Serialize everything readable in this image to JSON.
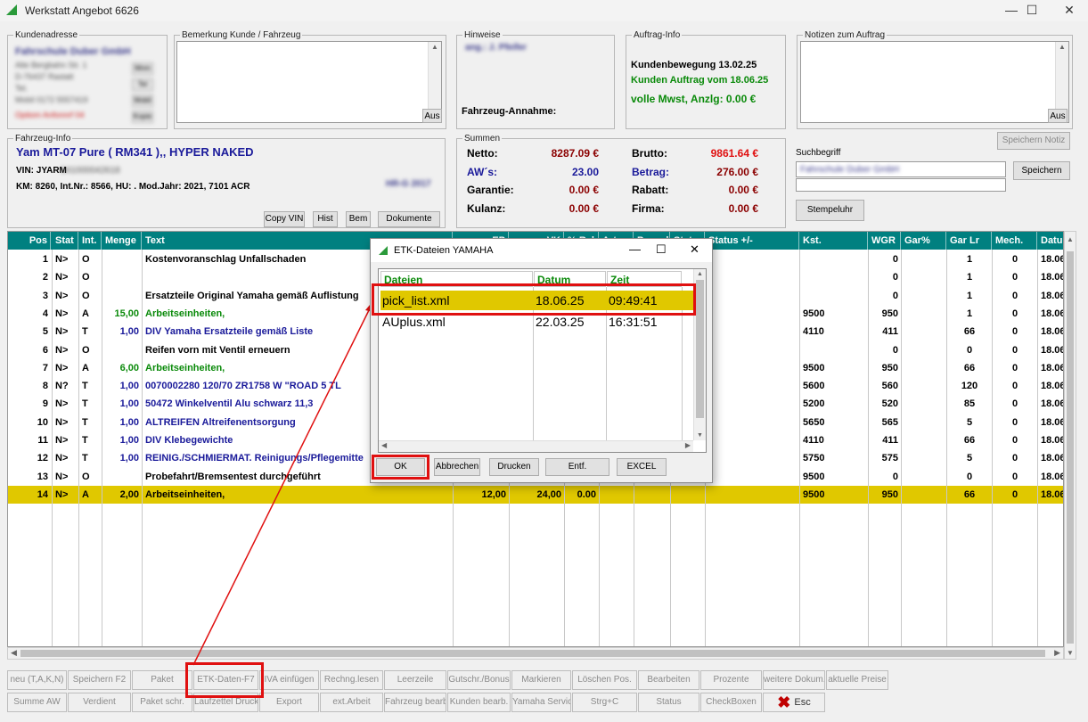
{
  "window": {
    "title": "Werkstatt Angebot 6626",
    "minimize": "—",
    "maximize": "☐",
    "close": "✕"
  },
  "kunde": {
    "legend": "Kundenadresse",
    "lines": [
      "Fahrschule Duber GmbH",
      "Alte Bergbahn Str. 1",
      "D-76437 Rastatt",
      "Tel.",
      "Mobil 0172 5557419",
      "Optiom Anfonnrf 04"
    ],
    "side_btns": [
      "Mnm",
      "Tel",
      "Mobil",
      "Kopie"
    ]
  },
  "bemerkung": {
    "legend": "Bemerkung Kunde / Fahrzeug",
    "aus": "Aus"
  },
  "hinweise": {
    "legend": "Hinweise",
    "line1": "ang.: J. Pfeifer",
    "annahme": "Fahrzeug-Annahme:"
  },
  "auftrag": {
    "legend": "Auftrag-Info",
    "line1": "Kundenbewegung 13.02.25",
    "line2": "Kunden Auftrag vom 18.06.25",
    "line3": "volle Mwst, Anzlg: 0.00 €"
  },
  "notizen": {
    "legend": "Notizen zum Auftrag",
    "aus": "Aus",
    "speichern": "Speichern Notiz"
  },
  "fahrzeug": {
    "legend": "Fahrzeug-Info",
    "title": "Yam MT-07 Pure ( RM341 ),, HYPER NAKED",
    "vin_label": "VIN: JYARM",
    "vin_blur": "341000042618",
    "km": "KM: 8260, Int.Nr.: 8566, HU:  .  Mod.Jahr: 2021, 7101 ACR",
    "plate": "HR-G 2017",
    "buttons": {
      "copy_vin": "Copy VIN",
      "hist": "Hist",
      "bem": "Bem",
      "dokumente": "Dokumente"
    }
  },
  "summen": {
    "legend": "Summen",
    "netto_l": "Netto:",
    "netto_v": "8287.09 €",
    "aws_l": "AW´s:",
    "aws_v": "23.00",
    "garantie_l": "Garantie:",
    "garantie_v": "0.00 €",
    "kulanz_l": "Kulanz:",
    "kulanz_v": "0.00 €",
    "brutto_l": "Brutto:",
    "brutto_v": "9861.64 €",
    "betrag_l": "Betrag:",
    "betrag_v": "276.00 €",
    "rabatt_l": "Rabatt:",
    "rabatt_v": "0.00 €",
    "firma_l": "Firma:",
    "firma_v": "0.00 €"
  },
  "such": {
    "label": "Suchbegriff",
    "value": "Fahrschule Duber GmbH",
    "speichern": "Speichern",
    "stempeluhr": "Stempeluhr"
  },
  "grid": {
    "headers": [
      "Pos",
      "Stat",
      "Int.",
      "Menge",
      "Text",
      "EP",
      "VK",
      "% Rab",
      "Art",
      "Pauschal",
      "Stat",
      "Status +/-",
      "Kst.",
      "WGR",
      "Gar%",
      "Gar Lr",
      "Mech.",
      "Datum"
    ],
    "rows": [
      {
        "pos": "1",
        "stat": "N>",
        "int": "O",
        "menge": "",
        "text": "Kostenvoranschlag Unfallschaden",
        "ep": "",
        "vk": "",
        "rab": "",
        "kst": "",
        "wgr": "0",
        "garlr": "1",
        "mech": "0",
        "datum": "18.06",
        "color": "#000000"
      },
      {
        "pos": "2",
        "stat": "N>",
        "int": "O",
        "menge": "",
        "text": "",
        "ep": "",
        "vk": "",
        "rab": "",
        "kst": "",
        "wgr": "0",
        "garlr": "1",
        "mech": "0",
        "datum": "18.06",
        "color": "#000000"
      },
      {
        "pos": "3",
        "stat": "N>",
        "int": "O",
        "menge": "",
        "text": "Ersatzteile Original Yamaha gemäß Auflistung",
        "ep": "",
        "vk": "",
        "rab": "",
        "kst": "",
        "wgr": "0",
        "garlr": "1",
        "mech": "0",
        "datum": "18.06",
        "color": "#000000"
      },
      {
        "pos": "4",
        "stat": "N>",
        "int": "A",
        "menge": "15,00",
        "text": "Arbeitseinheiten,",
        "ep": "",
        "vk": "",
        "rab": "",
        "kst": "9500",
        "wgr": "950",
        "garlr": "1",
        "mech": "0",
        "datum": "18.06",
        "color": "#0a8a0a"
      },
      {
        "pos": "5",
        "stat": "N>",
        "int": "T",
        "menge": "1,00",
        "text": "DIV  Yamaha Ersatzteile gemäß Liste",
        "ep": "",
        "vk": "",
        "rab": "",
        "kst": "4110",
        "wgr": "411",
        "garlr": "66",
        "mech": "0",
        "datum": "18.06",
        "color": "#1a1a9a"
      },
      {
        "pos": "6",
        "stat": "N>",
        "int": "O",
        "menge": "",
        "text": "Reifen vorn mit Ventil erneuern",
        "ep": "",
        "vk": "",
        "rab": "",
        "kst": "",
        "wgr": "0",
        "garlr": "0",
        "mech": "0",
        "datum": "18.06",
        "color": "#000000"
      },
      {
        "pos": "7",
        "stat": "N>",
        "int": "A",
        "menge": "6,00",
        "text": "Arbeitseinheiten,",
        "ep": "",
        "vk": "",
        "rab": "",
        "kst": "9500",
        "wgr": "950",
        "garlr": "66",
        "mech": "0",
        "datum": "18.06",
        "color": "#0a8a0a"
      },
      {
        "pos": "8",
        "stat": "N?",
        "int": "T",
        "menge": "1,00",
        "text": "0070002280          120/70 ZR1758 W \"ROAD 5 TL",
        "ep": "",
        "vk": "",
        "rab": "",
        "kst": "5600",
        "wgr": "560",
        "garlr": "120",
        "mech": "0",
        "datum": "18.06",
        "color": "#1a1a9a"
      },
      {
        "pos": "9",
        "stat": "N>",
        "int": "T",
        "menge": "1,00",
        "text": "50472                 Winkelventil Alu schwarz  11,3",
        "ep": "",
        "vk": "",
        "rab": "",
        "kst": "5200",
        "wgr": "520",
        "garlr": "85",
        "mech": "0",
        "datum": "18.06",
        "color": "#1a1a9a"
      },
      {
        "pos": "10",
        "stat": "N>",
        "int": "T",
        "menge": "1,00",
        "text": "ALTREIFEN           Altreifenentsorgung",
        "ep": "",
        "vk": "",
        "rab": "",
        "kst": "5650",
        "wgr": "565",
        "garlr": "5",
        "mech": "0",
        "datum": "18.06",
        "color": "#1a1a9a"
      },
      {
        "pos": "11",
        "stat": "N>",
        "int": "T",
        "menge": "1,00",
        "text": "DIV                   Klebegewichte",
        "ep": "",
        "vk": "",
        "rab": "",
        "kst": "4110",
        "wgr": "411",
        "garlr": "66",
        "mech": "0",
        "datum": "18.06",
        "color": "#1a1a9a"
      },
      {
        "pos": "12",
        "stat": "N>",
        "int": "T",
        "menge": "1,00",
        "text": "REINIG./SCHMIERMAT.  Reinigungs/Pflegemitte",
        "ep": "",
        "vk": "",
        "rab": "",
        "kst": "5750",
        "wgr": "575",
        "garlr": "5",
        "mech": "0",
        "datum": "18.06",
        "color": "#1a1a9a"
      },
      {
        "pos": "13",
        "stat": "N>",
        "int": "O",
        "menge": "",
        "text": "Probefahrt/Bremsentest durchgeführt",
        "ep": "",
        "vk": "",
        "rab": "",
        "kst": "9500",
        "wgr": "0",
        "garlr": "0",
        "mech": "0",
        "datum": "18.06",
        "color": "#000000"
      },
      {
        "pos": "14",
        "stat": "N>",
        "int": "A",
        "menge": "2,00",
        "text": "Arbeitseinheiten,",
        "ep": "12,00",
        "vk": "24,00",
        "rab": "0.00",
        "kst": "9500",
        "wgr": "950",
        "garlr": "66",
        "mech": "0",
        "datum": "18.06",
        "color": "#000000"
      }
    ]
  },
  "toolbar": {
    "row1": [
      "neu (T,A,K,N)",
      "Speichern F2",
      "Paket",
      "ETK-Daten-F7",
      "IVA einfügen",
      "Rechng.lesen",
      "Leerzeile",
      "Gutschr./Bonus",
      "Markieren",
      "Löschen Pos.",
      "Bearbeiten",
      "Prozente",
      "weitere Dokum.",
      "aktuelle Preise"
    ],
    "row2": [
      "Summe AW",
      "Verdient",
      "Paket schr.",
      "Laufzettel Druck",
      "Export",
      "ext.Arbeit",
      "Fahrzeug bearb.",
      "Kunden bearb.",
      "Yamaha Service",
      "Strg+C",
      "Status",
      "CheckBoxen",
      "Esc"
    ]
  },
  "dialog": {
    "title": "ETK-Dateien YAMAHA",
    "minimize": "—",
    "maximize": "☐",
    "close": "✕",
    "headers": [
      "Dateien",
      "Datum",
      "Zeit"
    ],
    "files": [
      {
        "name": "pick_list.xml",
        "datum": "18.06.25",
        "zeit": "09:49:41"
      },
      {
        "name": "AUplus.xml",
        "datum": "22.03.25",
        "zeit": "16:31:51"
      }
    ],
    "buttons": {
      "ok": "OK",
      "abbrechen": "Abbrechen",
      "drucken": "Drucken",
      "entf": "Entf.",
      "excel": "EXCEL"
    }
  },
  "colors": {
    "teal_header": "#008080",
    "highlight": "#e0c800",
    "annotation_red": "#e01010",
    "green": "#0a8a0a",
    "blue": "#1a1a9a",
    "darkred": "#8b0000"
  }
}
